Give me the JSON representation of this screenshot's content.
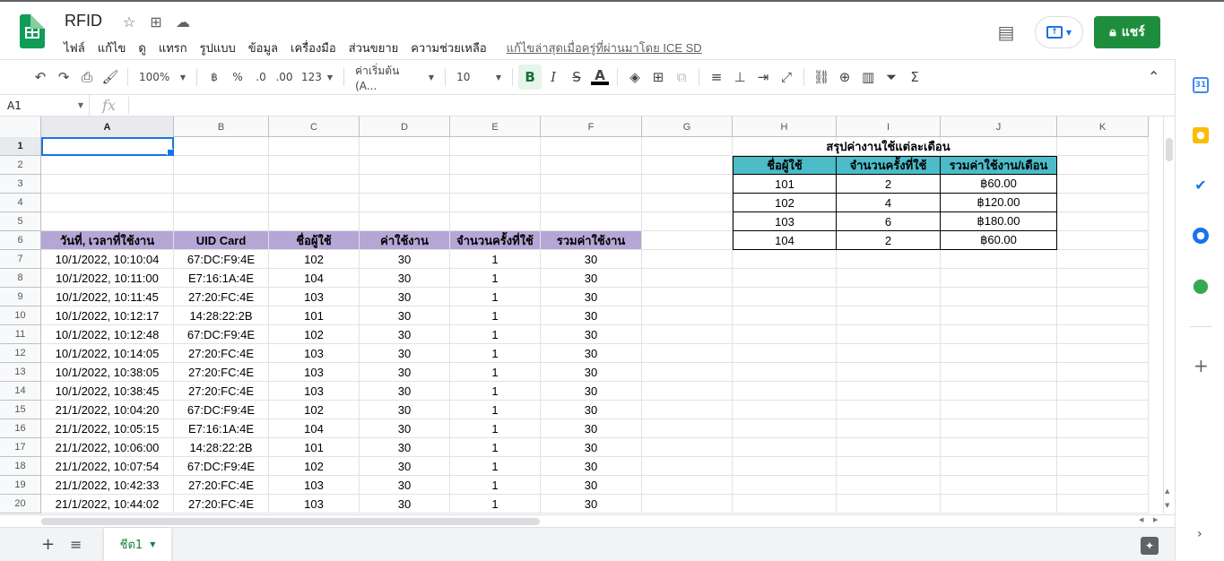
{
  "app": {
    "title": "RFID",
    "menu": [
      "ไฟล์",
      "แก้ไข",
      "ดู",
      "แทรก",
      "รูปแบบ",
      "ข้อมูล",
      "เครื่องมือ",
      "ส่วนขยาย",
      "ความช่วยเหลือ"
    ],
    "last_edit": "แก้ไขล่าสุดเมื่อครู่ที่ผ่านมาโดย ICE SD",
    "share_label": "แชร์",
    "colors": {
      "share": "#1e8e3e",
      "purple_header": "#b4a7d6",
      "teal_header": "#4bbcc8",
      "selection": "#1a73e8"
    }
  },
  "toolbar": {
    "zoom": "100%",
    "currency": "฿",
    "percent": "%",
    "dec_less": ".0",
    "dec_more": ".00",
    "format_more": "123",
    "font": "ค่าเริ่มต้น (A...",
    "font_size": "10",
    "bold": "B",
    "italic": "I",
    "strike": "S",
    "text_color": "A"
  },
  "formula_bar": {
    "cell_ref": "A1",
    "fx": "fx",
    "value": ""
  },
  "columns": [
    "A",
    "B",
    "C",
    "D",
    "E",
    "F",
    "G",
    "H",
    "I",
    "J",
    "K"
  ],
  "row_numbers": [
    "1",
    "2",
    "3",
    "4",
    "5",
    "6",
    "7",
    "8",
    "9",
    "10",
    "11",
    "12",
    "13",
    "14",
    "15",
    "16",
    "17",
    "18",
    "19",
    "20"
  ],
  "log_table": {
    "headers": [
      "วันที่, เวลาที่ใช้งาน",
      "UID Card",
      "ชื่อผู้ใช้",
      "ค่าใช้งาน",
      "จำนวนครั้งที่ใช้",
      "รวมค่าใช้งาน"
    ],
    "rows": [
      [
        "10/1/2022, 10:10:04",
        "67:DC:F9:4E",
        "102",
        "30",
        "1",
        "30"
      ],
      [
        "10/1/2022, 10:11:00",
        "E7:16:1A:4E",
        "104",
        "30",
        "1",
        "30"
      ],
      [
        "10/1/2022, 10:11:45",
        "27:20:FC:4E",
        "103",
        "30",
        "1",
        "30"
      ],
      [
        "10/1/2022, 10:12:17",
        "14:28:22:2B",
        "101",
        "30",
        "1",
        "30"
      ],
      [
        "10/1/2022, 10:12:48",
        "67:DC:F9:4E",
        "102",
        "30",
        "1",
        "30"
      ],
      [
        "10/1/2022, 10:14:05",
        "27:20:FC:4E",
        "103",
        "30",
        "1",
        "30"
      ],
      [
        "10/1/2022, 10:38:05",
        "27:20:FC:4E",
        "103",
        "30",
        "1",
        "30"
      ],
      [
        "10/1/2022, 10:38:45",
        "27:20:FC:4E",
        "103",
        "30",
        "1",
        "30"
      ],
      [
        "21/1/2022, 10:04:20",
        "67:DC:F9:4E",
        "102",
        "30",
        "1",
        "30"
      ],
      [
        "21/1/2022, 10:05:15",
        "E7:16:1A:4E",
        "104",
        "30",
        "1",
        "30"
      ],
      [
        "21/1/2022, 10:06:00",
        "14:28:22:2B",
        "101",
        "30",
        "1",
        "30"
      ],
      [
        "21/1/2022, 10:07:54",
        "67:DC:F9:4E",
        "102",
        "30",
        "1",
        "30"
      ],
      [
        "21/1/2022, 10:42:33",
        "27:20:FC:4E",
        "103",
        "30",
        "1",
        "30"
      ],
      [
        "21/1/2022, 10:44:02",
        "27:20:FC:4E",
        "103",
        "30",
        "1",
        "30"
      ]
    ]
  },
  "summary_table": {
    "title": "สรุปค่างานใช้แต่ละเดือน",
    "headers": [
      "ชื่อผู้ใช้",
      "จำนวนครั้งที่ใช้",
      "รวมค่าใช้งาน/เดือน"
    ],
    "rows": [
      [
        "101",
        "2",
        "฿60.00"
      ],
      [
        "102",
        "4",
        "฿120.00"
      ],
      [
        "103",
        "6",
        "฿180.00"
      ],
      [
        "104",
        "2",
        "฿60.00"
      ]
    ]
  },
  "sheet_tab": "ชีต1",
  "side_panel": {
    "calendar_day": "31"
  }
}
